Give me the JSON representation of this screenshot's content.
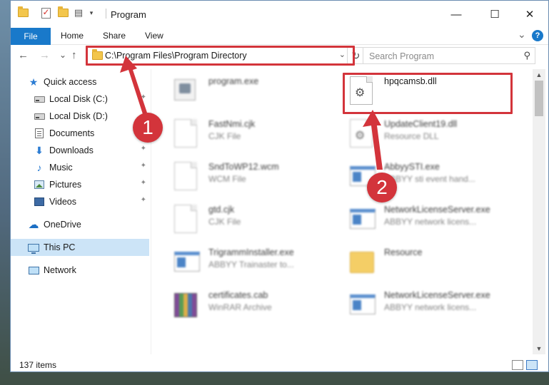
{
  "window": {
    "title": "Program",
    "minimize_glyph": "—",
    "maximize_glyph": "☐",
    "close_glyph": "✕"
  },
  "ribbon": {
    "tabs": [
      "File",
      "Home",
      "Share",
      "View"
    ],
    "expand_glyph": "⌄",
    "help_glyph": "?"
  },
  "nav": {
    "back_glyph": "←",
    "forward_glyph": "→",
    "recent_glyph": "⌄",
    "up_glyph": "↑",
    "address": "C:\\Program Files\\Program Directory",
    "address_dropdown_glyph": "⌄",
    "refresh_glyph": "↻",
    "search_placeholder": "Search Program",
    "search_glyph": "⚲"
  },
  "sidebar": {
    "items": [
      {
        "label": "Quick access",
        "icon": "star-icon"
      },
      {
        "label": "Local Disk (C:)",
        "icon": "disk-icon"
      },
      {
        "label": "Local Disk (D:)",
        "icon": "disk-icon"
      },
      {
        "label": "Documents",
        "icon": "documents-icon"
      },
      {
        "label": "Downloads",
        "icon": "downloads-icon"
      },
      {
        "label": "Music",
        "icon": "music-icon"
      },
      {
        "label": "Pictures",
        "icon": "pictures-icon"
      },
      {
        "label": "Videos",
        "icon": "videos-icon"
      },
      {
        "label": "OneDrive",
        "icon": "onedrive-icon"
      },
      {
        "label": "This PC",
        "icon": "pc-icon"
      },
      {
        "label": "Network",
        "icon": "network-icon"
      }
    ],
    "pin_glyph": "📌"
  },
  "files": [
    {
      "name": "program.exe",
      "type": "",
      "icon": "installer-icon"
    },
    {
      "name": "hpqcamsb.dll",
      "type": "",
      "icon": "dll-gear-icon"
    },
    {
      "name": "FastNmi.cjk",
      "type": "CJK File",
      "icon": "page-icon"
    },
    {
      "name": "UpdateClient19.dll",
      "type": "Resource DLL",
      "icon": "dll-gear-icon"
    },
    {
      "name": "SndToWP12.wcm",
      "type": "WCM File",
      "icon": "page-icon"
    },
    {
      "name": "AbbyySTI.exe",
      "type": "ABBYY sti event hand...",
      "icon": "app-icon"
    },
    {
      "name": "gtd.cjk",
      "type": "CJK File",
      "icon": "page-icon"
    },
    {
      "name": "NetworkLicenseServer.exe",
      "type": "ABBYY network licens...",
      "icon": "app-icon"
    },
    {
      "name": "TrigrammInstaller.exe",
      "type": "ABBYY Trainaster to...",
      "icon": "app-icon"
    },
    {
      "name": "Resource",
      "type": "",
      "icon": "folder-icon"
    },
    {
      "name": "certificates.cab",
      "type": "WinRAR Archive",
      "icon": "archive-icon"
    },
    {
      "name": "NetworkLicenseServer.exe",
      "type": "ABBYY network licens...",
      "icon": "app-icon"
    }
  ],
  "status": {
    "item_count": "137 items"
  },
  "callouts": {
    "step1": "1",
    "step2": "2"
  },
  "colors": {
    "accent": "#1979ca",
    "highlight": "#d3343b",
    "selection": "#cce4f7"
  }
}
